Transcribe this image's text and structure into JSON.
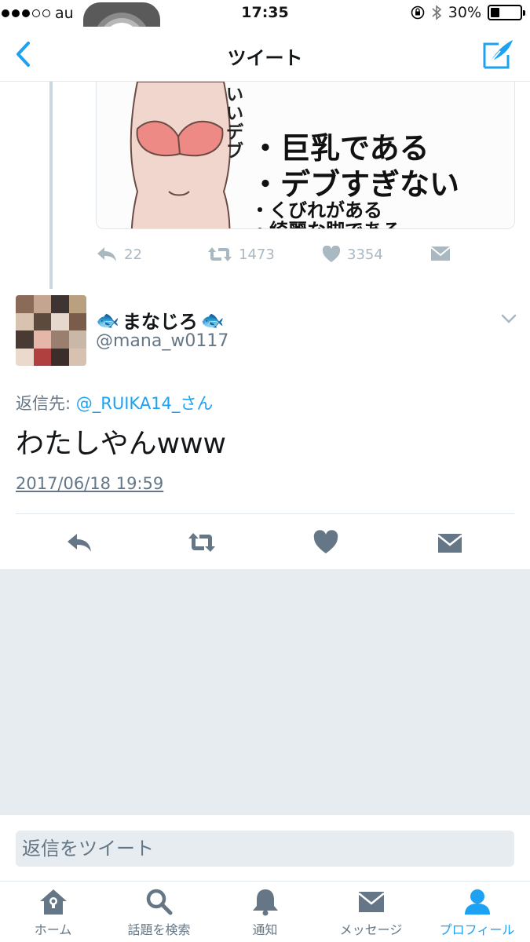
{
  "status_bar": {
    "carrier": "au",
    "time": "17:35",
    "battery_percent": "30%",
    "battery_level": 0.3
  },
  "nav": {
    "title": "ツイート",
    "back_icon": "chevron-left-icon",
    "compose_icon": "compose-tweet-icon"
  },
  "parent_tweet": {
    "media": {
      "caption_lines": [
        "・巨乳である",
        "・デブすぎない",
        "・くびれがある",
        "・綺麗な脚である"
      ],
      "vertical_text": "いいデブ"
    },
    "reply_count": "22",
    "retweet_count": "1473",
    "like_count": "3354"
  },
  "tweet": {
    "display_name": "まなじろ",
    "name_emoji": "🐟",
    "handle": "@mana_w0117",
    "reply_to_label": "返信先:",
    "reply_to_user": "@_RUIKA14_さん",
    "text": "わたしやんwww",
    "timestamp": "2017/06/18 19:59"
  },
  "composer": {
    "placeholder": "返信をツイート"
  },
  "tabbar": {
    "items": [
      {
        "label": "ホーム",
        "icon": "home-icon"
      },
      {
        "label": "話題を検索",
        "icon": "search-icon"
      },
      {
        "label": "通知",
        "icon": "bell-icon"
      },
      {
        "label": "メッセージ",
        "icon": "envelope-icon"
      },
      {
        "label": "プロフィール",
        "icon": "person-icon"
      }
    ],
    "active_index": 4
  },
  "colors": {
    "accent": "#1da1f2",
    "muted": "#657786",
    "action_gray": "#aab8c2",
    "action_dark": "#657786",
    "background_gray": "#e6ecf0"
  }
}
